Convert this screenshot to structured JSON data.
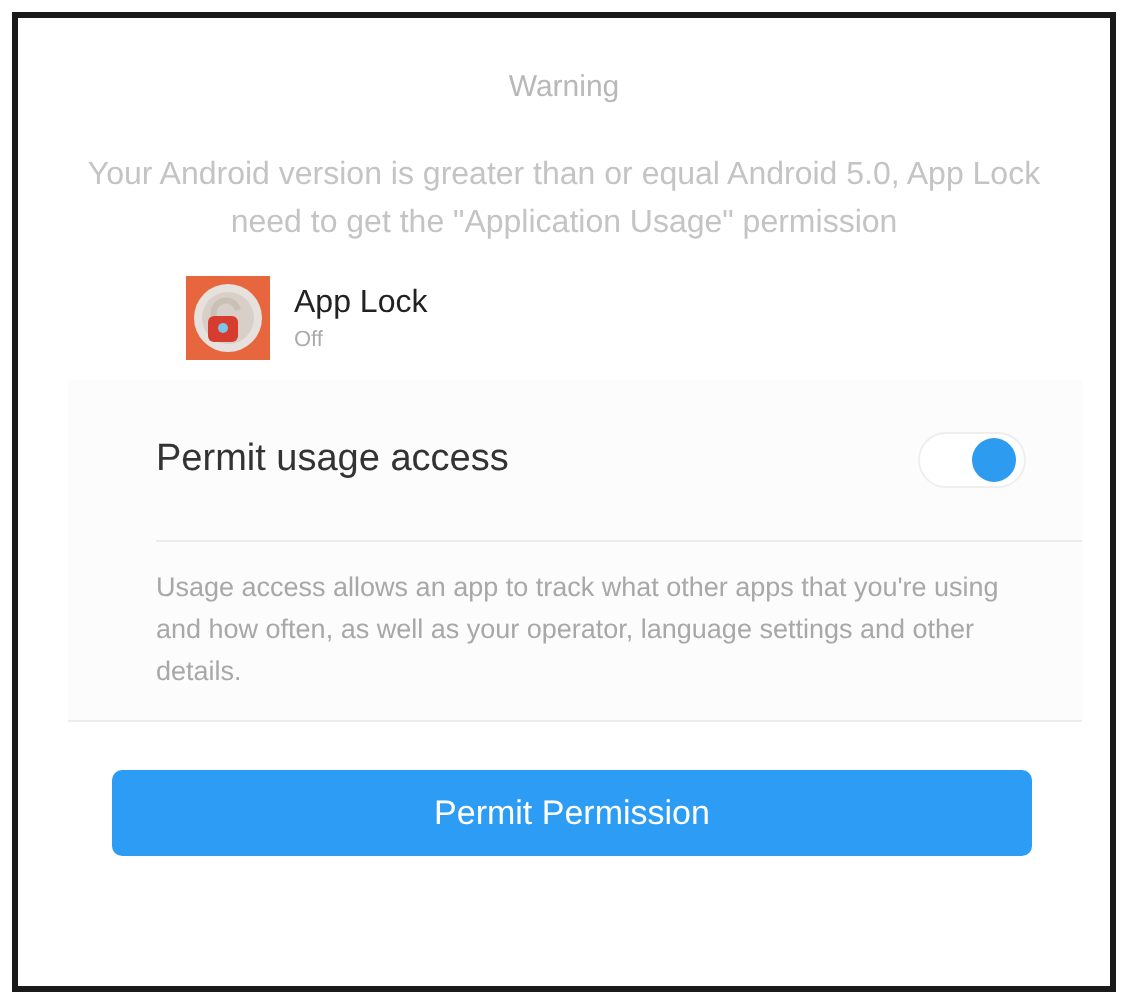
{
  "dialog": {
    "title": "Warning",
    "message": "Your Android version is greater than or equal Android 5.0, App Lock need to get the \"Application Usage\" permission",
    "app": {
      "name": "App Lock",
      "status": "Off"
    },
    "setting": {
      "label": "Permit usage access",
      "on": true,
      "description": "Usage access allows an app to track what other apps that you're using and how often, as well as your operator, language settings and other details."
    },
    "button": "Permit Permission"
  }
}
